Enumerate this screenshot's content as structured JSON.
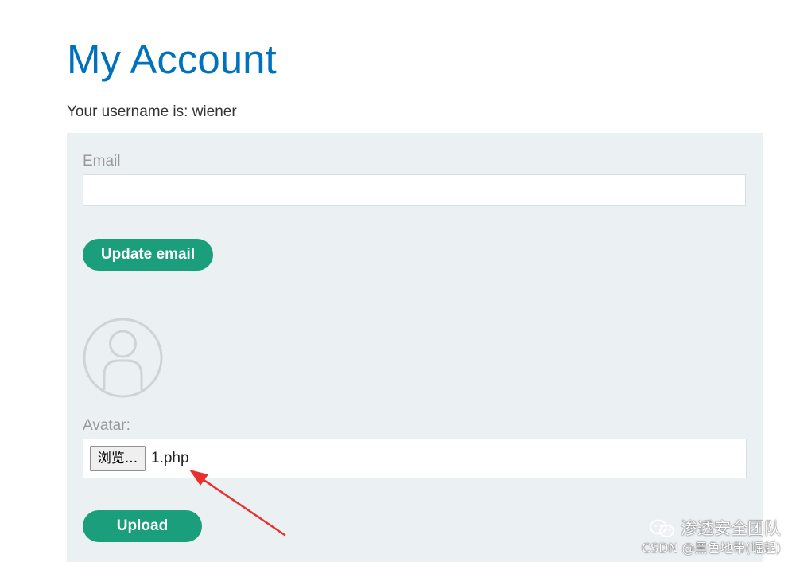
{
  "page": {
    "title": "My Account",
    "username_line": "Your username is: wiener"
  },
  "email_form": {
    "label": "Email",
    "value": "",
    "placeholder": "",
    "submit_label": "Update email"
  },
  "avatar_form": {
    "avatar_icon": "user-avatar-icon",
    "label": "Avatar:",
    "browse_label": "浏览...",
    "selected_file": "1.php",
    "submit_label": "Upload"
  },
  "annotation": {
    "arrow_color": "#e8312f"
  },
  "watermark": {
    "icon": "wechat-icon",
    "team_name": "渗透安全团队",
    "credit": "CSDN @黑色地带(崛起)"
  },
  "colors": {
    "title": "#0071bc",
    "button": "#1a9e7c",
    "panel": "#ebf0f2",
    "label": "#999999"
  }
}
